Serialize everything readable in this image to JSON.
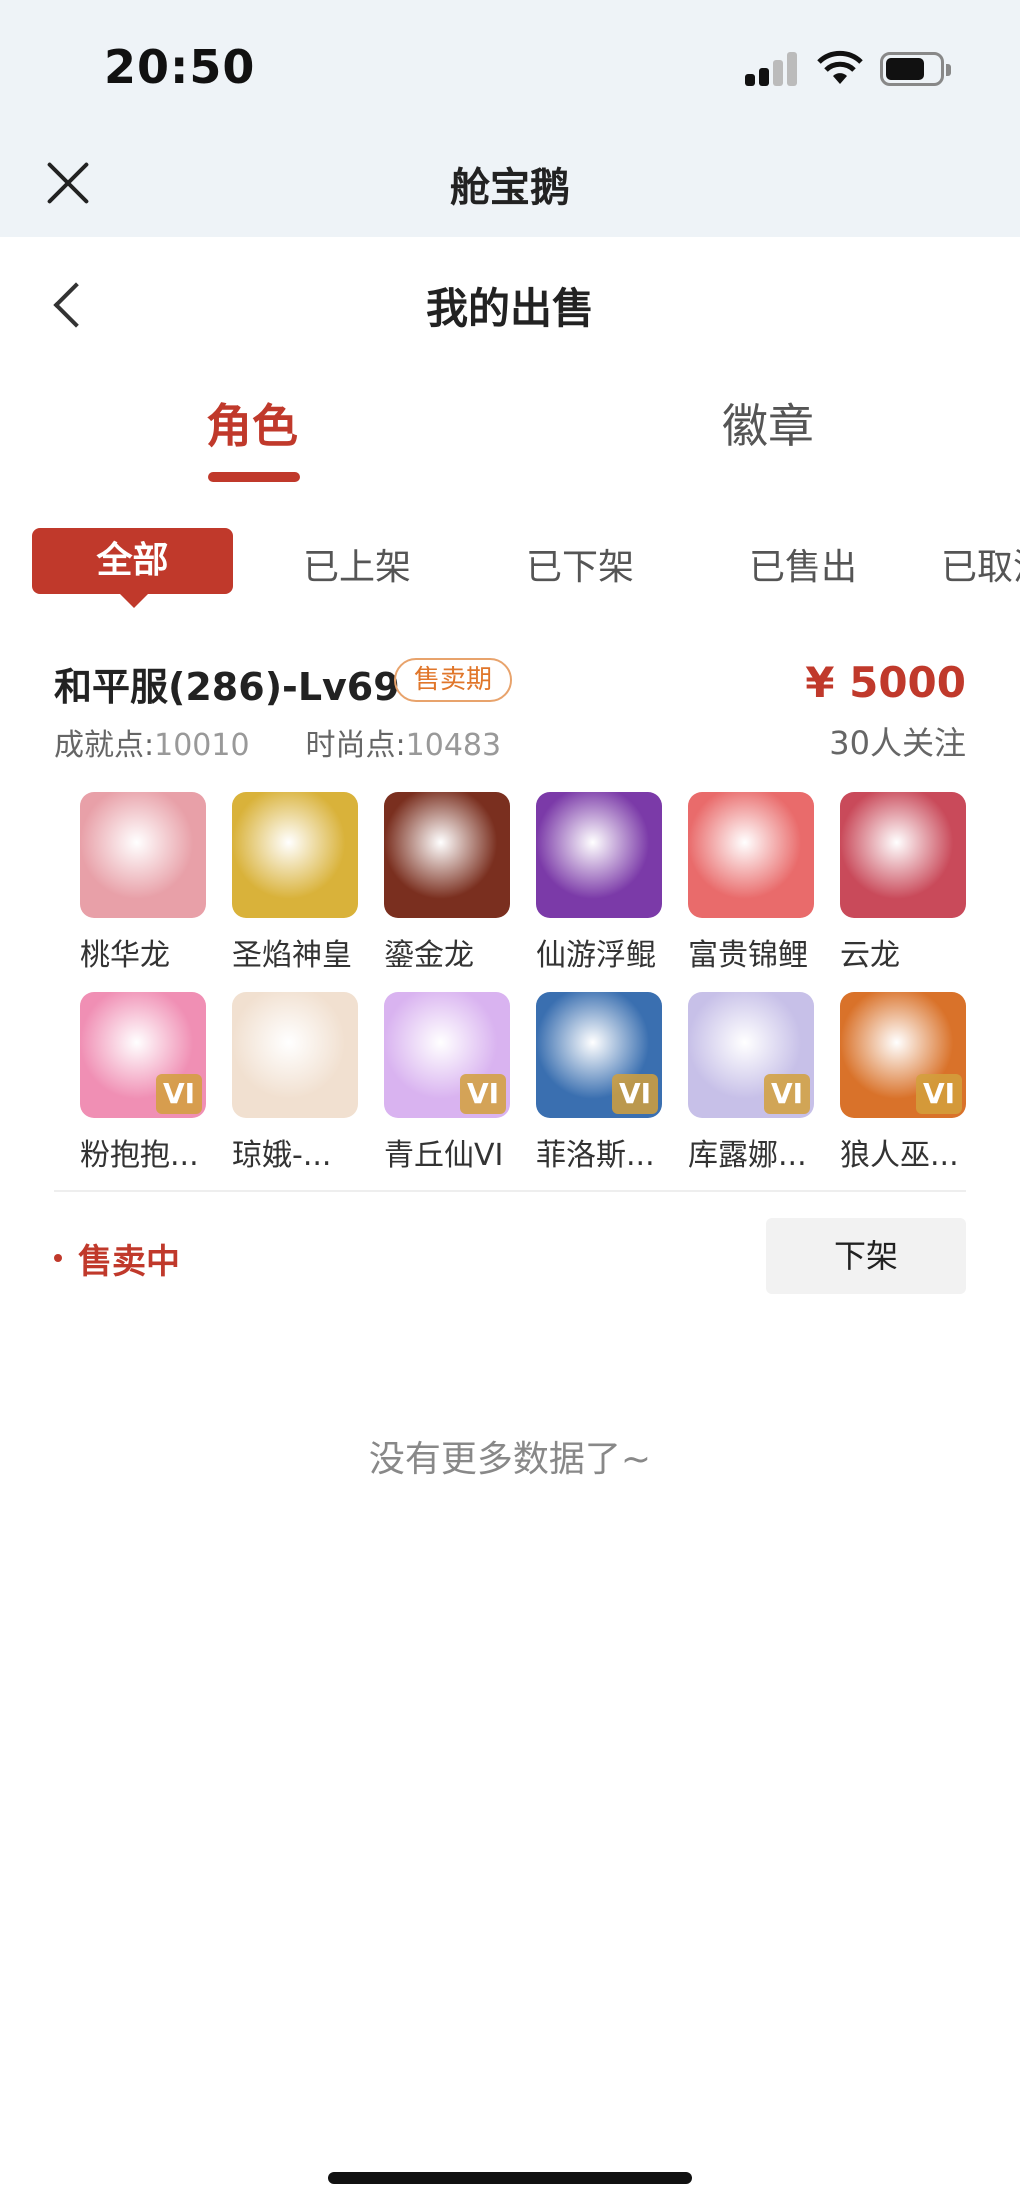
{
  "status_bar": {
    "time": "20:50"
  },
  "app": {
    "title": "舱宝鹅"
  },
  "page": {
    "title": "我的出售"
  },
  "main_tabs": [
    {
      "label": "角色",
      "active": true
    },
    {
      "label": "徽章",
      "active": false
    }
  ],
  "sub_tabs": [
    {
      "label": "全部",
      "active": true
    },
    {
      "label": "已上架"
    },
    {
      "label": "已下架"
    },
    {
      "label": "已售出"
    },
    {
      "label": "已取消"
    }
  ],
  "listing": {
    "server": "和平服(286)-Lv69",
    "badge": "售卖期",
    "price": "¥ 5000",
    "achievement_label": "成就点:",
    "achievement_value": "10010",
    "fashion_label": "时尚点:",
    "fashion_value": "10483",
    "followers": "30人关注",
    "items": [
      {
        "name": "桃华龙",
        "icon": "peach-dragon-icon",
        "color": "#e8a0a8"
      },
      {
        "name": "圣焰神皇",
        "icon": "golden-phoenix-icon",
        "color": "#d9b23a"
      },
      {
        "name": "鎏金龙",
        "icon": "gilded-dragon-icon",
        "color": "#7a2f1f"
      },
      {
        "name": "仙游浮鲲",
        "icon": "floating-kun-icon",
        "color": "#7b3aa8"
      },
      {
        "name": "富贵锦鲤",
        "icon": "koi-icon",
        "color": "#e96b6b"
      },
      {
        "name": "云龙",
        "icon": "cloud-dragon-icon",
        "color": "#c94a5a"
      },
      {
        "name": "粉抱抱...",
        "icon": "pink-bear-icon",
        "color": "#f08fb4",
        "vi": "VI"
      },
      {
        "name": "琼娥-...",
        "icon": "qiong-e-icon",
        "color": "#f1e0d0",
        "vi": ""
      },
      {
        "name": "青丘仙VI",
        "icon": "fox-fairy-icon",
        "color": "#d9b3f0",
        "vi": "VI"
      },
      {
        "name": "菲洛斯...",
        "icon": "philos-icon",
        "color": "#3a6fb0",
        "vi": "VI"
      },
      {
        "name": "库露娜...",
        "icon": "kuluna-icon",
        "color": "#c7c0e8",
        "vi": "VI"
      },
      {
        "name": "狼人巫...",
        "icon": "werewolf-icon",
        "color": "#d9722a",
        "vi": "VI"
      }
    ],
    "status": "售卖中",
    "action": "下架"
  },
  "footer": {
    "no_more": "没有更多数据了~"
  }
}
